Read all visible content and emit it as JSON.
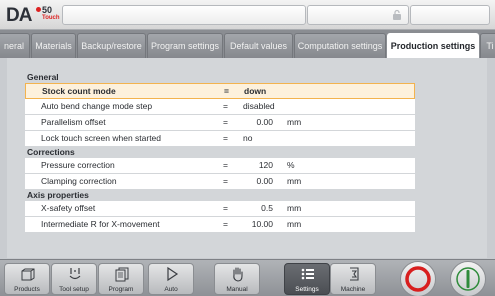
{
  "header": {
    "logo_main": "DA",
    "logo_version": "50",
    "logo_sub": "Touch",
    "brand_color": "#d22222"
  },
  "tabs": [
    {
      "label": "neral",
      "active": false
    },
    {
      "label": "Materials",
      "active": false
    },
    {
      "label": "Backup/restore",
      "active": false
    },
    {
      "label": "Program settings",
      "active": false
    },
    {
      "label": "Default values",
      "active": false
    },
    {
      "label": "Computation settings",
      "active": false
    },
    {
      "label": "Production settings",
      "active": true
    },
    {
      "label": "Ti",
      "active": false
    }
  ],
  "settings": {
    "general": {
      "title": "General",
      "rows": [
        {
          "label": "Stock count mode",
          "eq": "=",
          "value": "down",
          "unit": "",
          "selected": true
        },
        {
          "label": "Auto bend change mode step",
          "eq": "=",
          "value": "disabled",
          "unit": ""
        },
        {
          "label": "Parallelism offset",
          "eq": "=",
          "value": "0.00",
          "unit": "mm"
        },
        {
          "label": "Lock touch screen when started",
          "eq": "=",
          "value": "no",
          "unit": ""
        }
      ]
    },
    "corrections": {
      "title": "Corrections",
      "rows": [
        {
          "label": "Pressure correction",
          "eq": "=",
          "value": "120",
          "unit": "%"
        },
        {
          "label": "Clamping correction",
          "eq": "=",
          "value": "0.00",
          "unit": "mm"
        }
      ]
    },
    "axis": {
      "title": "Axis properties",
      "rows": [
        {
          "label": "X-safety offset",
          "eq": "=",
          "value": "0.5",
          "unit": "mm"
        },
        {
          "label": "Intermediate R for X-movement",
          "eq": "=",
          "value": "10.00",
          "unit": "mm"
        }
      ]
    }
  },
  "bottom_nav": [
    {
      "label": "Products",
      "icon": "products-icon"
    },
    {
      "label": "Tool setup",
      "icon": "tool-setup-icon"
    },
    {
      "label": "Program",
      "icon": "program-icon"
    },
    {
      "label": "Auto",
      "icon": "play-icon"
    },
    {
      "label": "Manual",
      "icon": "hand-icon"
    },
    {
      "label": "Settings",
      "icon": "settings-list-icon",
      "active": true
    },
    {
      "label": "Machine",
      "icon": "machine-icon"
    }
  ],
  "colors": {
    "stop_button": "#d81e1e",
    "start_button": "#2e8b3a",
    "selected_row": "#fdf1dc",
    "selected_border": "#f3b34e"
  }
}
